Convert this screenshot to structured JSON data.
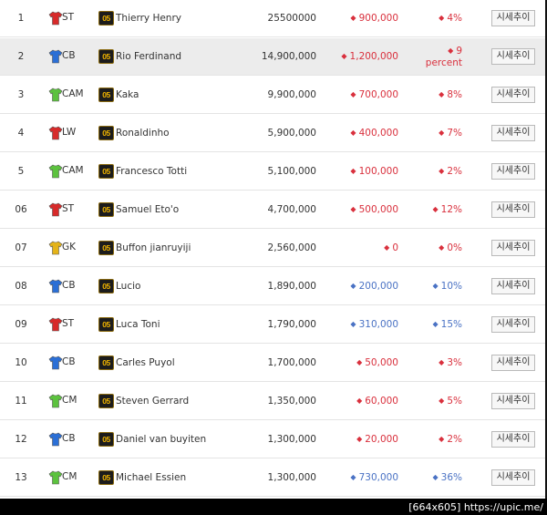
{
  "colors": {
    "up": "#d9303d",
    "down": "#4a72c4",
    "red_shirt": "#d72a2a",
    "blue_shirt": "#2b6fd6",
    "green_shirt": "#5cc23e",
    "yellow_shirt": "#e4b318"
  },
  "rows": [
    {
      "rank": "1",
      "pos": "ST",
      "shirt": "red",
      "badge": "05",
      "name": "Thierry Henry",
      "price": "25500000",
      "change": "900,000",
      "dir": "up",
      "pct": "4%"
    },
    {
      "rank": "2",
      "pos": "CB",
      "shirt": "blue",
      "badge": "05",
      "name": "Rio Ferdinand",
      "price": "14,900,000",
      "change": "1,200,000",
      "dir": "up",
      "pct": "9 percent",
      "highlight": true
    },
    {
      "rank": "3",
      "pos": "CAM",
      "shirt": "green",
      "badge": "05",
      "name": "Kaka",
      "price": "9,900,000",
      "change": "700,000",
      "dir": "up",
      "pct": "8%"
    },
    {
      "rank": "4",
      "pos": "LW",
      "shirt": "red",
      "badge": "05",
      "name": "Ronaldinho",
      "price": "5,900,000",
      "change": "400,000",
      "dir": "up",
      "pct": "7%"
    },
    {
      "rank": "5",
      "pos": "CAM",
      "shirt": "green",
      "badge": "05",
      "name": "Francesco Totti",
      "price": "5,100,000",
      "change": "100,000",
      "dir": "up",
      "pct": "2%"
    },
    {
      "rank": "06",
      "pos": "ST",
      "shirt": "red",
      "badge": "05",
      "name": "Samuel Eto'o",
      "price": "4,700,000",
      "change": "500,000",
      "dir": "up",
      "pct": "12%"
    },
    {
      "rank": "07",
      "pos": "GK",
      "shirt": "yellow",
      "badge": "05",
      "name": "Buffon jianruyiji",
      "price": "2,560,000",
      "change": "0",
      "dir": "up",
      "pct": "0%"
    },
    {
      "rank": "08",
      "pos": "CB",
      "shirt": "blue",
      "badge": "05",
      "name": "Lucio",
      "price": "1,890,000",
      "change": "200,000",
      "dir": "down",
      "pct": "10%"
    },
    {
      "rank": "09",
      "pos": "ST",
      "shirt": "red",
      "badge": "05",
      "name": "Luca Toni",
      "price": "1,790,000",
      "change": "310,000",
      "dir": "down",
      "pct": "15%"
    },
    {
      "rank": "10",
      "pos": "CB",
      "shirt": "blue",
      "badge": "05",
      "name": "Carles Puyol",
      "price": "1,700,000",
      "change": "50,000",
      "dir": "up",
      "pct": "3%"
    },
    {
      "rank": "11",
      "pos": "CM",
      "shirt": "green",
      "badge": "05",
      "name": "Steven Gerrard",
      "price": "1,350,000",
      "change": "60,000",
      "dir": "up",
      "pct": "5%"
    },
    {
      "rank": "12",
      "pos": "CB",
      "shirt": "blue",
      "badge": "05",
      "name": "Daniel van buyiten",
      "price": "1,300,000",
      "change": "20,000",
      "dir": "up",
      "pct": "2%"
    },
    {
      "rank": "13",
      "pos": "CM",
      "shirt": "green",
      "badge": "05",
      "name": "Michael Essien",
      "price": "1,300,000",
      "change": "730,000",
      "dir": "down",
      "pct": "36%"
    }
  ],
  "button_label": "시세추이",
  "watermark": "[664x605] https://upic.me/"
}
